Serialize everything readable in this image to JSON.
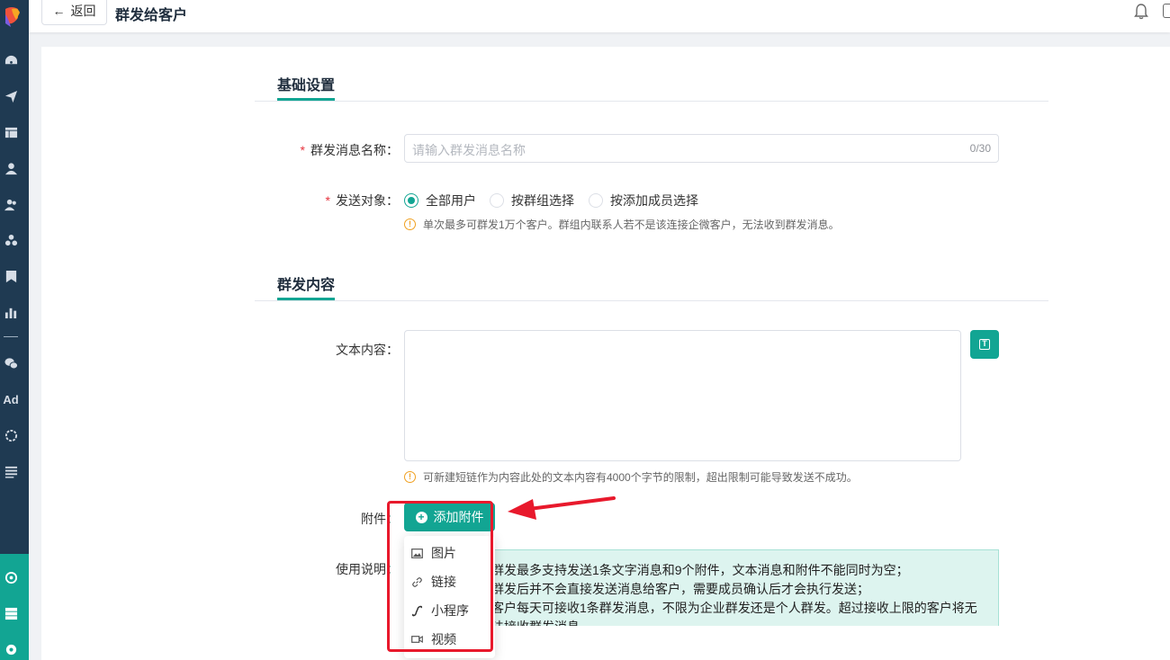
{
  "header": {
    "back_label": "返回",
    "title": "群发给客户"
  },
  "section_basic": {
    "title": "基础设置"
  },
  "name_field": {
    "label": "群发消息名称：",
    "placeholder": "请输入群发消息名称",
    "counter": "0/30"
  },
  "target_field": {
    "label": "发送对象：",
    "options": [
      "全部用户",
      "按群组选择",
      "按添加成员选择"
    ],
    "selected": "全部用户",
    "tip": "单次最多可群发1万个客户。群组内联系人若不是该连接企微客户，无法收到群发消息。"
  },
  "section_content": {
    "title": "群发内容"
  },
  "text_field": {
    "label": "文本内容：",
    "tip": "可新建短链作为内容此处的文本内容有4000个字节的限制，超出限制可能导致发送不成功。"
  },
  "attachment": {
    "label": "附件：",
    "button_label": "添加附件",
    "menu": [
      {
        "label": "图片",
        "icon": "image-icon"
      },
      {
        "label": "链接",
        "icon": "link-icon"
      },
      {
        "label": "小程序",
        "icon": "mini-program-icon"
      },
      {
        "label": "视频",
        "icon": "video-icon"
      }
    ]
  },
  "usage": {
    "label": "使用说明：",
    "lines": [
      "群发最多支持发送1条文字消息和9个附件，文本消息和附件不能同时为空；",
      "群发后并不会直接发送消息给客户，需要成员确认后才会执行发送；",
      "客户每天可接收1条群发消息，不限为企业群发还是个人群发。超过接收上限的客户将无",
      "法接收群发消息。"
    ]
  },
  "colors": {
    "accent": "#12a593",
    "sidebar": "#1f3a52",
    "highlight": "#e8192c"
  }
}
